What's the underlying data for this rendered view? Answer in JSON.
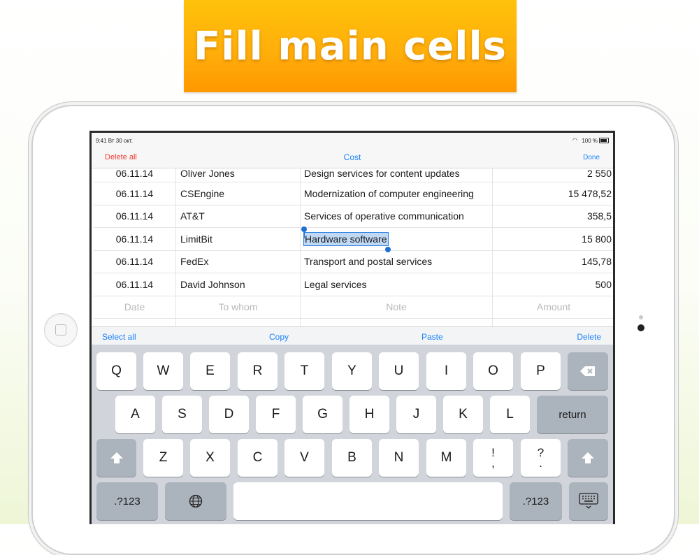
{
  "banner": {
    "text": "Fill main cells"
  },
  "status": {
    "time_date": "9:41  Вт 30 окт.",
    "battery": "100 %"
  },
  "nav": {
    "left": "Delete all",
    "title": "Cost",
    "right": "Done"
  },
  "rows": [
    {
      "date": "06.11.14",
      "to": "Oliver Jones",
      "note": "Design services for content updates",
      "amount": "2 550"
    },
    {
      "date": "06.11.14",
      "to": "CSEngine",
      "note": "Modernization of computer engineering",
      "amount": "15 478,52"
    },
    {
      "date": "06.11.14",
      "to": "AT&T",
      "note": "Services of operative communication",
      "amount": "358,5"
    },
    {
      "date": "06.11.14",
      "to": "LimitBit",
      "note": "Hardware software",
      "amount": "15 800"
    },
    {
      "date": "06.11.14",
      "to": "FedEx",
      "note": "Transport and postal services",
      "amount": "145,78"
    },
    {
      "date": "06.11.14",
      "to": "David Johnson",
      "note": "Legal services",
      "amount": "500"
    }
  ],
  "placeholder": {
    "date": "Date",
    "to": "To whom",
    "note": "Note",
    "amount": "Amount"
  },
  "editbar": {
    "select_all": "Select all",
    "copy": "Copy",
    "paste": "Paste",
    "delete": "Delete"
  },
  "keyboard": {
    "row1": [
      "Q",
      "W",
      "E",
      "R",
      "T",
      "Y",
      "U",
      "I",
      "O",
      "P"
    ],
    "row2": [
      "A",
      "S",
      "D",
      "F",
      "G",
      "H",
      "J",
      "K",
      "L"
    ],
    "row3": [
      "Z",
      "X",
      "C",
      "V",
      "B",
      "N",
      "M"
    ],
    "return": "return",
    "numbers": ".?123",
    "exclam_top": "!",
    "exclam_bottom": ",",
    "question_top": "?",
    "question_bottom": "."
  },
  "colors": {
    "accent": "#1a82fb",
    "destructive": "#ef3b2f",
    "banner": "#ffad0a"
  }
}
